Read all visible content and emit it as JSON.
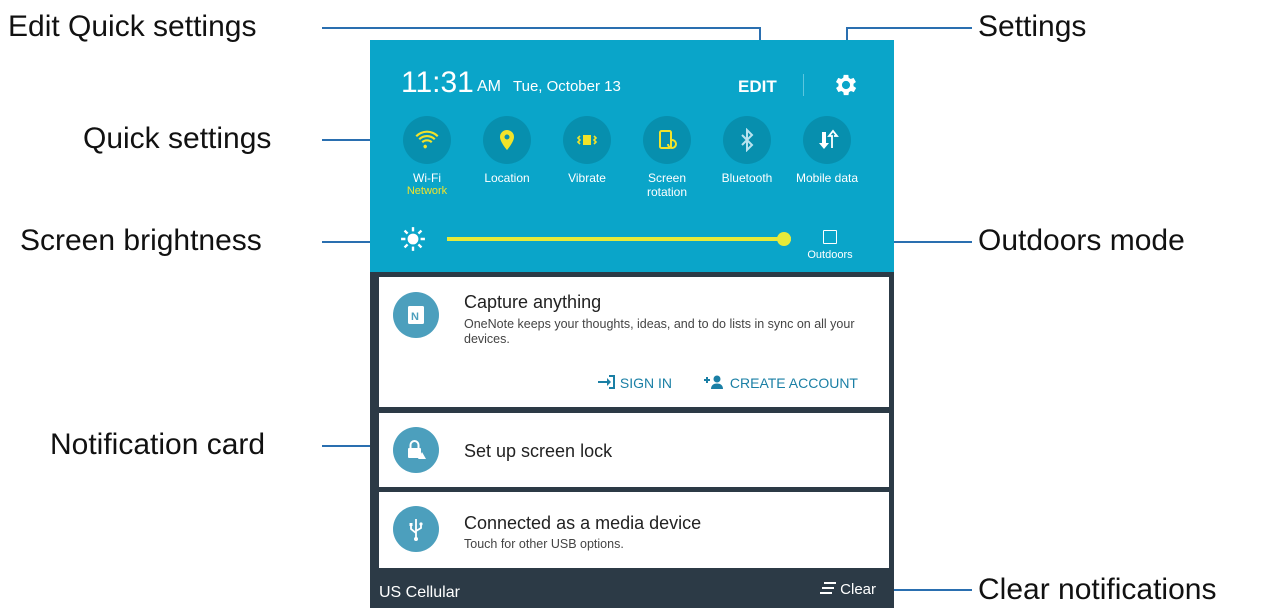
{
  "callouts": {
    "edit_quick_settings": "Edit Quick settings",
    "settings": "Settings",
    "quick_settings": "Quick settings",
    "screen_brightness": "Screen brightness",
    "outdoors_mode": "Outdoors mode",
    "notification_card": "Notification card",
    "clear_notifications": "Clear notifications"
  },
  "status": {
    "time": "11:31",
    "ampm": "AM",
    "date": "Tue, October 13",
    "edit": "EDIT"
  },
  "tiles": [
    {
      "label": "Wi-Fi",
      "sub": "Network",
      "icon": "wifi-icon",
      "active": true
    },
    {
      "label": "Location",
      "sub": "",
      "icon": "location-icon",
      "active": true
    },
    {
      "label": "Vibrate",
      "sub": "",
      "icon": "vibrate-icon",
      "active": true
    },
    {
      "label": "Screen rotation",
      "sub": "",
      "icon": "screen-rotation-icon",
      "active": true
    },
    {
      "label": "Bluetooth",
      "sub": "",
      "icon": "bluetooth-icon",
      "active": false
    },
    {
      "label": "Mobile data",
      "sub": "",
      "icon": "mobile-data-icon",
      "active": false
    }
  ],
  "brightness": {
    "level": 0.98,
    "outdoors_label": "Outdoors"
  },
  "notifications": [
    {
      "title": "Capture anything",
      "body": "OneNote keeps your thoughts, ideas, and to do lists in sync on all your devices.",
      "icon": "onenote-icon",
      "actions": [
        {
          "label": "SIGN IN",
          "icon": "sign-in-icon"
        },
        {
          "label": "CREATE ACCOUNT",
          "icon": "add-person-icon"
        }
      ]
    },
    {
      "title": "Set up screen lock",
      "body": "",
      "icon": "lock-icon"
    },
    {
      "title": "Connected as a media device",
      "body": "Touch for other USB options.",
      "icon": "usb-icon"
    }
  ],
  "footer": {
    "carrier": "US Cellular",
    "clear": "Clear"
  },
  "colors": {
    "panel": "#0aa5c9",
    "tile": "#078fae",
    "accent": "#f2e32a",
    "callout_line": "#2a6fb0"
  }
}
